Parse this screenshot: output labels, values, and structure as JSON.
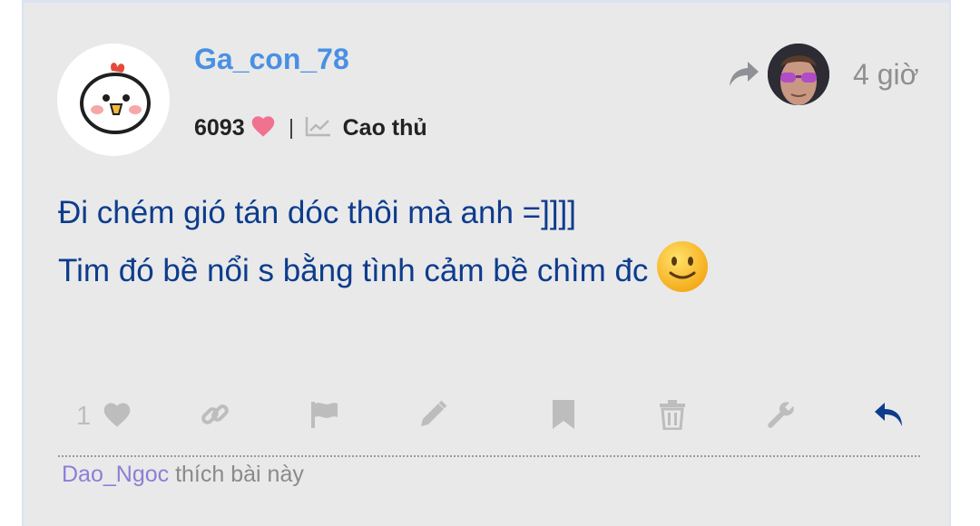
{
  "post": {
    "username": "Ga_con_78",
    "points": "6093",
    "rank_label": "Cao thủ",
    "time": "4 giờ",
    "content_lines": [
      "Đi chém gió tán dóc thôi mà anh =]]]]",
      "Tim đó bề nổi s bằng tình cảm bề chìm đc"
    ],
    "like_count": "1",
    "liked_by_user": "Dao_Ngoc",
    "liked_suffix": " thích bài này"
  },
  "icons": {
    "avatar": "chick-avatar",
    "heart": "heart-icon",
    "rank": "trend-chart-icon",
    "share": "share-arrow-icon",
    "emoji": "slightly-smiling-face",
    "actions": [
      "heart-icon",
      "link-icon",
      "flag-icon",
      "pencil-icon",
      "bookmark-icon",
      "trash-icon",
      "wrench-icon",
      "reply-icon"
    ]
  },
  "colors": {
    "username": "#4a90e2",
    "content": "#0d3c8c",
    "heart_pink": "#f0728f",
    "action_gray": "#bdbdbd",
    "reply_blue": "#0d3c8c",
    "liker_name": "#8b7fd6"
  }
}
